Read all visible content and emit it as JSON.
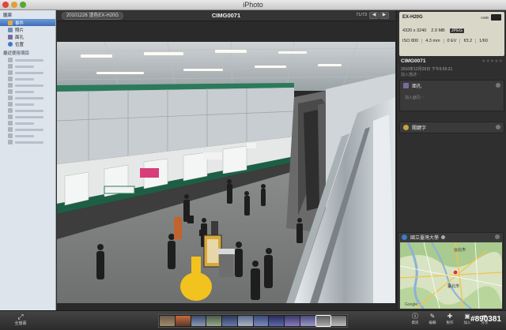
{
  "window": {
    "title": "iPhoto"
  },
  "sidebar": {
    "library_header": "圖庫",
    "items": [
      {
        "label": "事件",
        "icon": "events-icon",
        "color": "#e8a73a",
        "selected": true
      },
      {
        "label": "照片",
        "icon": "photos-icon",
        "color": "#6f8fb8",
        "selected": false
      },
      {
        "label": "面孔",
        "icon": "faces-icon",
        "color": "#7b6a9e",
        "selected": false
      },
      {
        "label": "位置",
        "icon": "places-icon",
        "color": "#3f79c6",
        "selected": false
      }
    ],
    "recent_header": "最近使用項目"
  },
  "topbar": {
    "event_name": "20101226 渣色EX-H20G",
    "photo_title": "CIMG0071",
    "count": "71/73",
    "prev": "◀",
    "next": "▶"
  },
  "info": {
    "camera": "EX-H20G",
    "awb": "AWB",
    "resolution": "4320 x 3240",
    "filesize": "2.9 MB",
    "format": "JPEG",
    "iso": "ISO 800",
    "focal": "4.3 mm",
    "ev": "0 EV",
    "aperture": "f/3.2",
    "shutter": "1/60",
    "name": "CIMG0071",
    "stars": "★★★★★",
    "date": "2010年12月26日 下午6:55:21",
    "description_placeholder": "加入描述⋯",
    "faces_label": "面孔",
    "faces_placeholder": "加入面孔⋯",
    "keywords_label": "關鍵字",
    "places_label": "國立臺灣大學",
    "map_labels": [
      "台北市",
      "臺北市"
    ]
  },
  "bottombar": {
    "fullscreen_label": "全螢幕",
    "tools": [
      {
        "label": "資訊",
        "icon": "info-icon",
        "glyph": "ⓘ"
      },
      {
        "label": "編輯",
        "icon": "edit-icon",
        "glyph": "✎"
      },
      {
        "label": "製作",
        "icon": "create-icon",
        "glyph": "✚"
      },
      {
        "label": "加入",
        "icon": "add-to-icon",
        "glyph": "▣"
      },
      {
        "label": "分享",
        "icon": "share-icon",
        "glyph": "➦"
      }
    ]
  },
  "watermark": "#890381"
}
